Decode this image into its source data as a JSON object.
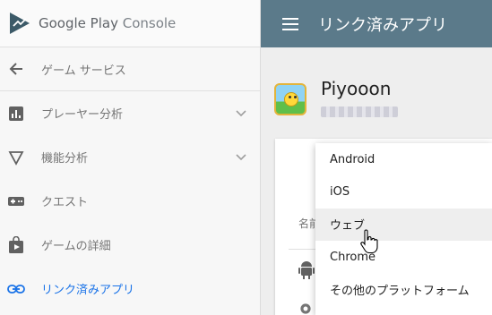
{
  "brand": {
    "name_main": "Google Play",
    "name_console": "Console"
  },
  "sidebar": {
    "items": [
      {
        "label": "ゲーム サービス",
        "icon": "arrow-back-icon"
      },
      {
        "label": "プレーヤー分析",
        "icon": "bar-chart-icon",
        "expandable": true
      },
      {
        "label": "機能分析",
        "icon": "funnel-icon",
        "expandable": true
      },
      {
        "label": "クエスト",
        "icon": "gamepad-icon"
      },
      {
        "label": "ゲームの詳細",
        "icon": "play-bag-icon"
      },
      {
        "label": "リンク済みアプリ",
        "icon": "link-icon",
        "active": true
      }
    ]
  },
  "header": {
    "title": "リンク済みアプリ"
  },
  "app": {
    "name": "Piyooon"
  },
  "card": {
    "label": "名前"
  },
  "dropdown": {
    "items": [
      "Android",
      "iOS",
      "ウェブ",
      "Chrome",
      "その他のプラットフォーム"
    ],
    "hovered_index": 2
  },
  "colors": {
    "header_bg": "#5b7a8a",
    "active_link": "#1a73e8"
  }
}
